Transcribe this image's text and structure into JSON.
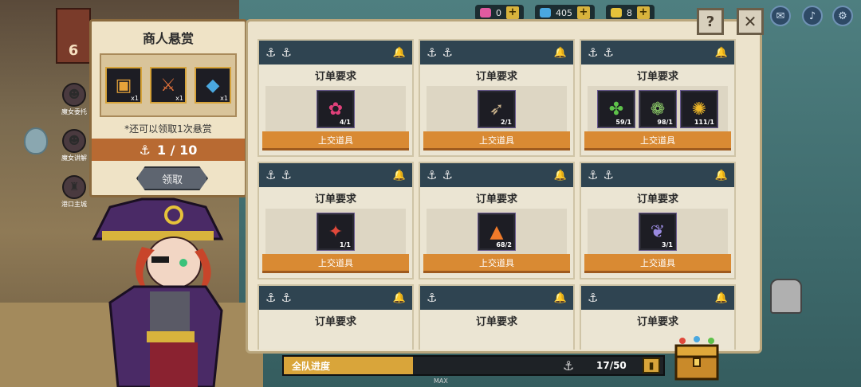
{
  "topbar": {
    "resources": [
      {
        "icon": "pink-gem-icon",
        "value": "0",
        "color": "#e05aa0"
      },
      {
        "icon": "blue-gem-icon",
        "value": "405",
        "color": "#4aa8e0"
      },
      {
        "icon": "gold-coin-icon",
        "value": "8",
        "color": "#e6c23a"
      }
    ],
    "system_buttons": [
      "mail-icon",
      "sound-icon",
      "settings-icon"
    ]
  },
  "bounty": {
    "title": "商人悬赏",
    "items": [
      {
        "icon": "chest-icon",
        "glyph": "▣",
        "count": "x1"
      },
      {
        "icon": "sword-icon",
        "glyph": "⚔",
        "count": "x1"
      },
      {
        "icon": "crystal-icon",
        "glyph": "◆",
        "count": "x1"
      }
    ],
    "note": "*还可以领取1次悬赏",
    "progress_icon": "⚓",
    "progress": "1 / 10",
    "claim_label": "领取"
  },
  "side": {
    "house_number": "6",
    "icons": [
      {
        "name": "witch-icon-1",
        "glyph": "☻",
        "label": "魔女委托"
      },
      {
        "name": "witch-icon-2",
        "glyph": "☻",
        "label": "魔女讲解"
      },
      {
        "name": "port-icon",
        "glyph": "♜",
        "label": "港口主城"
      }
    ]
  },
  "orders": [
    {
      "title": "订单要求",
      "button": "上交道具",
      "items": [
        {
          "icon": "pink-coral-icon",
          "glyph": "✿",
          "color": "#e0407a",
          "count": "4/1"
        }
      ]
    },
    {
      "title": "订单要求",
      "button": "上交道具",
      "items": [
        {
          "icon": "fish-icon",
          "glyph": "➶",
          "color": "#c8b08a",
          "count": "2/1"
        }
      ]
    },
    {
      "title": "订单要求",
      "button": "上交道具",
      "items": [
        {
          "icon": "green-herb-icon",
          "glyph": "✤",
          "color": "#5ec24a",
          "count": "59/1"
        },
        {
          "icon": "cabbage-icon",
          "glyph": "❁",
          "color": "#8fd06a",
          "count": "98/1"
        },
        {
          "icon": "sunflower-icon",
          "glyph": "✺",
          "color": "#f0b828",
          "count": "111/1"
        }
      ]
    },
    {
      "title": "订单要求",
      "button": "上交道具",
      "items": [
        {
          "icon": "crab-icon",
          "glyph": "✦",
          "color": "#e0483a",
          "count": "1/1"
        }
      ]
    },
    {
      "title": "订单要求",
      "button": "上交道具",
      "items": [
        {
          "icon": "carrot-icon",
          "glyph": "▲",
          "color": "#f07a2a",
          "count": "68/2"
        }
      ]
    },
    {
      "title": "订单要求",
      "button": "上交道具",
      "items": [
        {
          "icon": "feather-icon",
          "glyph": "❦",
          "color": "#9a8ae0",
          "count": "3/1"
        }
      ]
    },
    {
      "title": "订单要求",
      "button": "",
      "items": []
    },
    {
      "title": "订单要求",
      "button": "",
      "items": []
    },
    {
      "title": "订单要求",
      "button": "",
      "items": []
    }
  ],
  "team": {
    "label": "全队进度",
    "count": "17/50",
    "progress_fraction": 0.34,
    "max_label": "MAX"
  },
  "help_label": "?",
  "close_label": "✕"
}
